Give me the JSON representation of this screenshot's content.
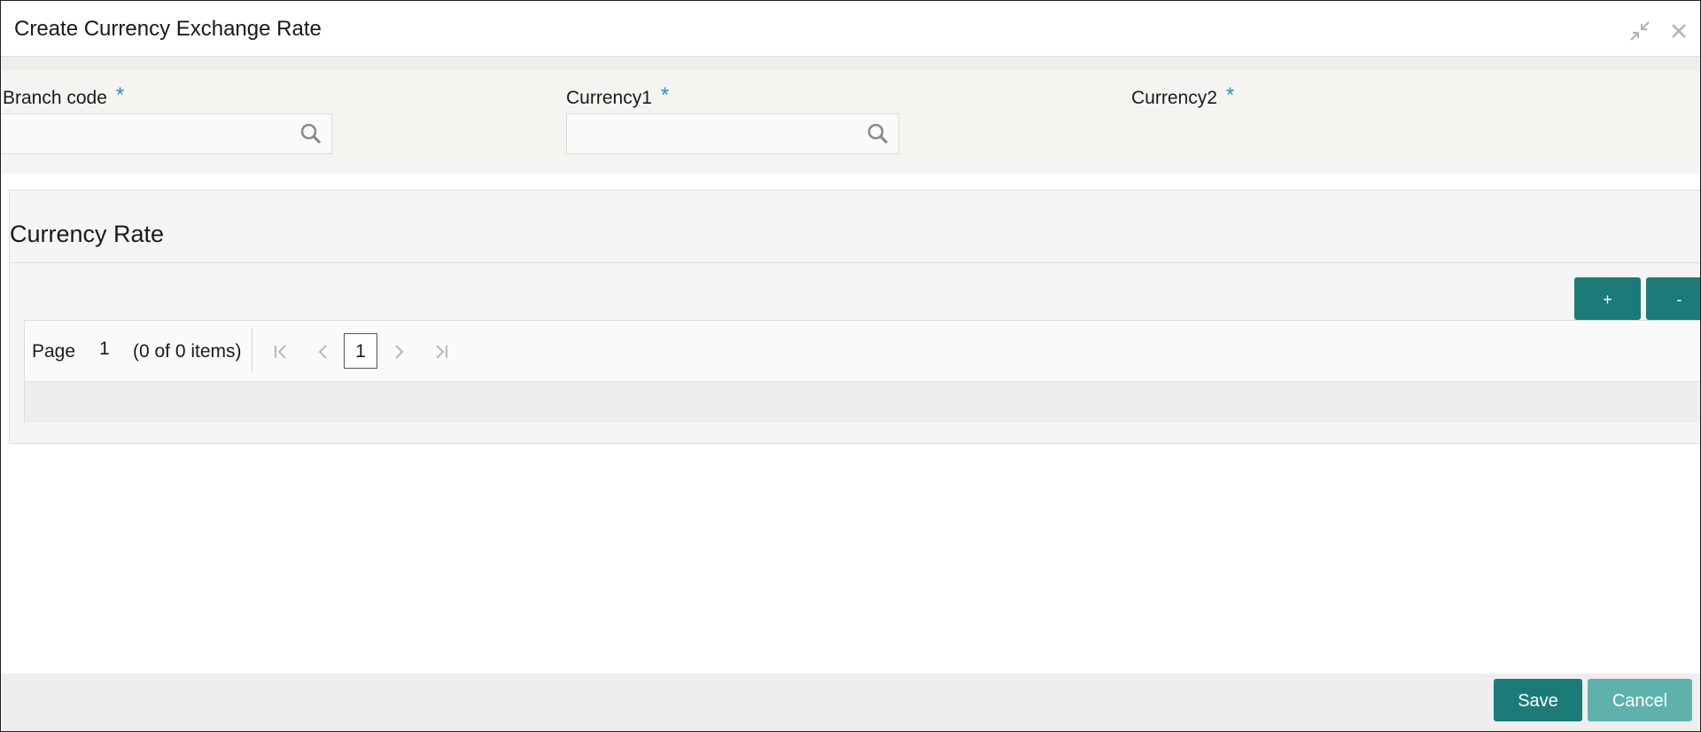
{
  "window": {
    "title": "Create Currency Exchange Rate",
    "minimize_icon": "minimize-arrows-icon",
    "close_icon": "close-icon"
  },
  "fields": {
    "branch_code": {
      "label": "Branch code",
      "required": "*",
      "value": ""
    },
    "currency1": {
      "label": "Currency1",
      "required": "*",
      "value": ""
    },
    "currency2": {
      "label": "Currency2",
      "required": "*"
    }
  },
  "currency_rate": {
    "title": "Currency Rate",
    "add_label": "+",
    "remove_label": "-",
    "pager": {
      "page_label": "Page",
      "page_number": "1",
      "item_count": "(0 of 0 items)",
      "current_page": "1"
    },
    "rows": []
  },
  "footer": {
    "save_label": "Save",
    "cancel_label": "Cancel"
  },
  "colors": {
    "primary_button": "#1c7a78",
    "secondary_button": "#5fb2ac",
    "required_marker": "#2f8fc2"
  }
}
